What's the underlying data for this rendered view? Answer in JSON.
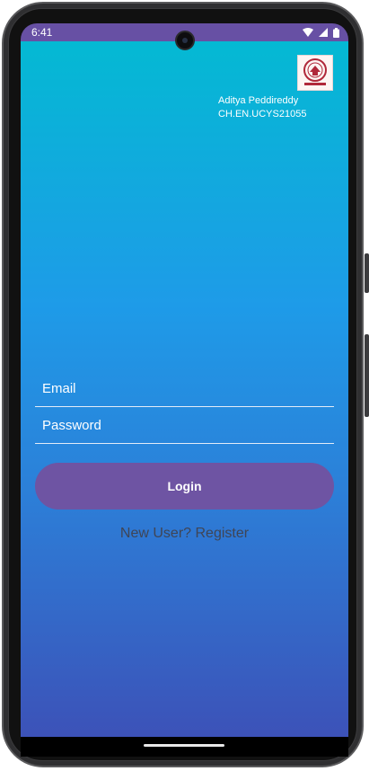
{
  "status_bar": {
    "time": "6:41",
    "color": "#6750a4"
  },
  "app": {
    "gradient_colors": [
      "#04b9d3",
      "#1e9be8",
      "#3c52b8"
    ],
    "logo_icon": "university-seal-icon",
    "user": {
      "name": "Aditya Peddireddy",
      "id": "CH.EN.UCYS21055"
    },
    "form": {
      "email_placeholder": "Email",
      "password_placeholder": "Password",
      "login_label": "Login",
      "login_color": "#6e54a3",
      "register_label": "New User? Register"
    }
  }
}
